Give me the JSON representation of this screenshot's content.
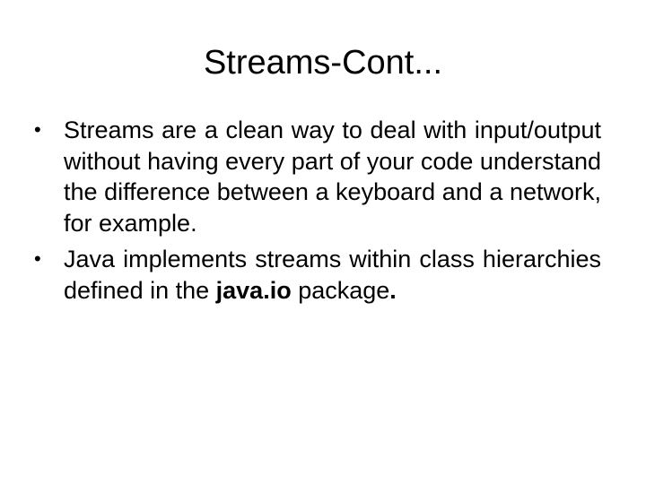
{
  "slide": {
    "title": "Streams-Cont...",
    "bullets": [
      {
        "text": "Streams are a clean way to deal with input/output without having every part of your code understand the difference between a keyboard and a network, for example."
      },
      {
        "text_before": "Java implements streams within class hierarchies defined in the ",
        "bold": "java.io",
        "text_middle": " package",
        "bold_end": "."
      }
    ],
    "bullet_glyph": "•"
  }
}
